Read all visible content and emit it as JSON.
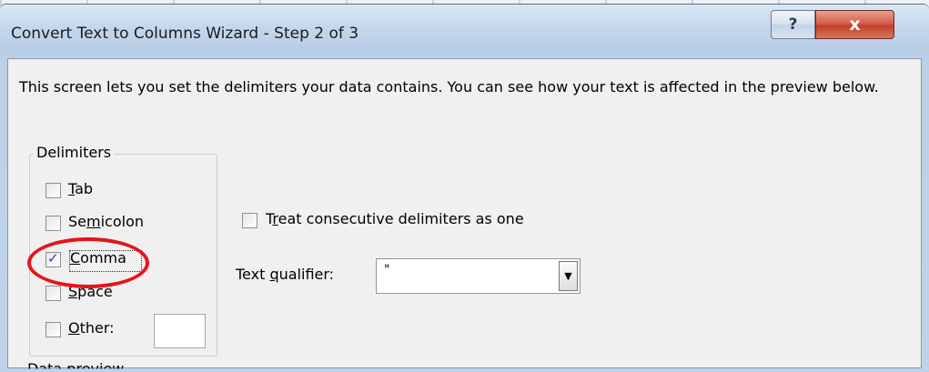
{
  "window": {
    "title": "Convert Text to Columns Wizard - Step 2 of 3",
    "help_label": "?",
    "close_label": "x"
  },
  "intro_text": "This screen lets you set the delimiters your data contains.  You can see how your text is affected in the preview below.",
  "delimiters": {
    "legend": "Delimiters",
    "tab": {
      "pre": "",
      "key": "T",
      "post": "ab",
      "checked": false
    },
    "semicolon": {
      "pre": "Se",
      "key": "m",
      "post": "icolon",
      "checked": false
    },
    "comma": {
      "pre": "",
      "key": "C",
      "post": "omma",
      "checked": true
    },
    "space": {
      "pre": "",
      "key": "S",
      "post": "pace",
      "checked": false
    },
    "other": {
      "pre": "",
      "key": "O",
      "post": "ther:",
      "checked": false,
      "value": ""
    }
  },
  "consecutive": {
    "pre": "T",
    "key": "r",
    "post": "eat consecutive delimiters as one",
    "checked": false
  },
  "text_qualifier": {
    "label_pre": "Text ",
    "label_key": "q",
    "label_post": "ualifier:",
    "value": "\"",
    "arrow": "▼"
  },
  "next_section_partial": "Data preview",
  "colors": {
    "highlight": "#e8131b",
    "close_button": "#c2402a"
  }
}
